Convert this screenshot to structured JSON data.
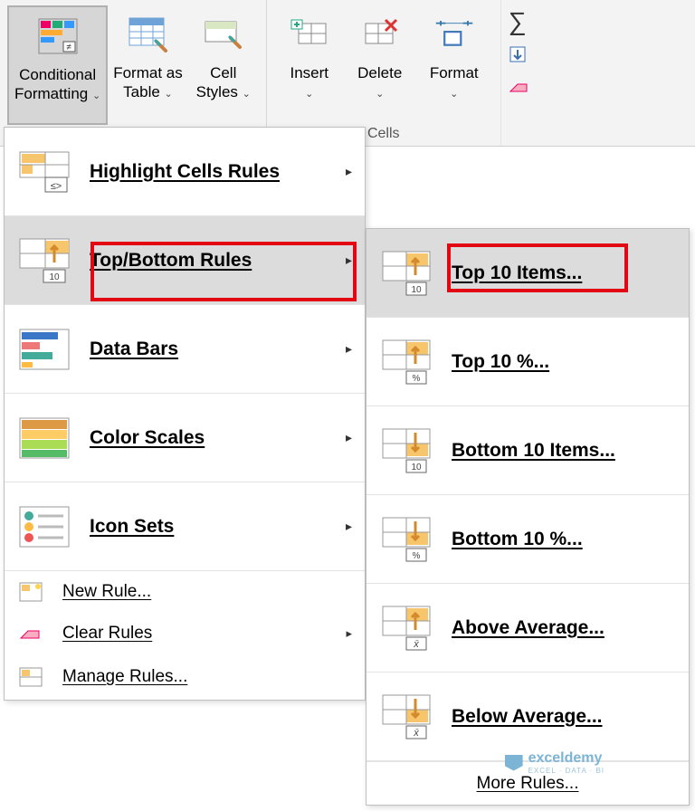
{
  "ribbon": {
    "conditional_formatting": "Conditional\nFormatting",
    "format_as_table": "Format as\nTable",
    "cell_styles": "Cell\nStyles",
    "insert": "Insert",
    "delete": "Delete",
    "format": "Format",
    "cells_group_label": "Cells"
  },
  "cf_menu": {
    "highlight_cells": "Highlight Cells Rules",
    "top_bottom": "Top/Bottom Rules",
    "data_bars": "Data Bars",
    "color_scales": "Color Scales",
    "icon_sets": "Icon Sets",
    "new_rule": "New Rule...",
    "clear_rules": "Clear Rules",
    "manage_rules": "Manage Rules..."
  },
  "tb_menu": {
    "top10_items": "Top 10 Items...",
    "top10_pct": "Top 10 %...",
    "bottom10_items": "Bottom 10 Items...",
    "bottom10_pct": "Bottom 10 %...",
    "above_avg": "Above Average...",
    "below_avg": "Below Average...",
    "more_rules": "More Rules..."
  },
  "watermark": {
    "text": "exceldemy",
    "sub": "EXCEL · DATA · BI"
  }
}
